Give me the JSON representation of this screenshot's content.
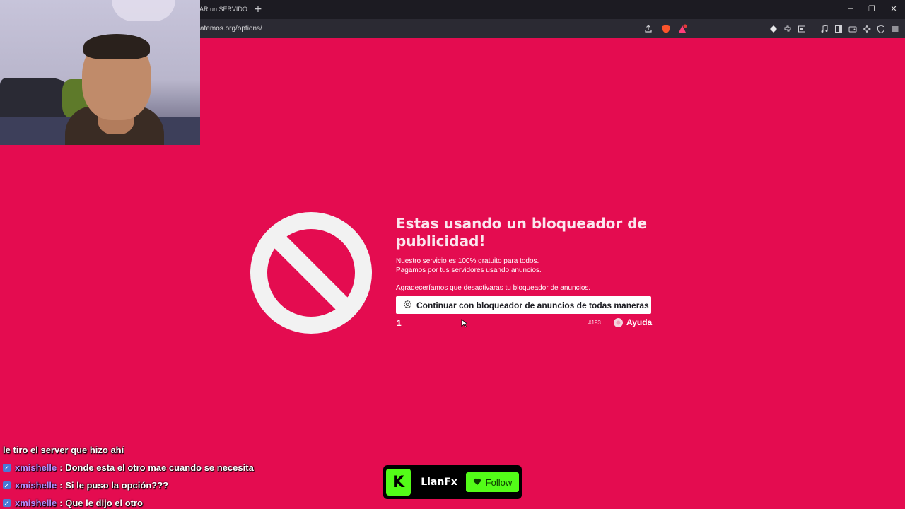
{
  "browser": {
    "tab_title": "AR un SERVIDOR",
    "new_tab": "+",
    "url": "atemos.org/options/",
    "window_controls": {
      "minimize": "─",
      "maximize": "❐",
      "close": "✕"
    },
    "toolbar_icons": [
      "share-icon",
      "shield-icon",
      "rewards-icon",
      "extension-icon",
      "puzzle-icon",
      "screenshot-icon",
      "media-icon",
      "sidebar-icon",
      "wallet-icon",
      "sparkle-icon",
      "vpn-icon",
      "menu-icon"
    ]
  },
  "page": {
    "background_color": "#e40c50",
    "title": "Estas usando un bloqueador de publicidad!",
    "line1": "Nuestro servicio es 100% gratuito para todos.",
    "line2": "Pagamos por tus servidores usando anuncios.",
    "thanks": "Agradeceríamos que desactivaras tu bloqueador de anuncios.",
    "continue_button": "Continuar con bloqueador de anuncios de todas maneras",
    "page_number": "1",
    "identifier": "#193",
    "help_label": "Ayuda"
  },
  "chat": {
    "messages": [
      {
        "user": "",
        "text": "le tiro el server que hizo ahí"
      },
      {
        "user": "xmishelle",
        "text": ": Donde esta el otro mae cuando se necesita"
      },
      {
        "user": "xmishelle",
        "text": ": Si le puso la opción???"
      },
      {
        "user": "xmishelle",
        "text": ": Que le dijo el otro"
      }
    ]
  },
  "kick": {
    "logo": "K",
    "streamer": "LianFx",
    "follow_label": "Follow",
    "accent": "#53fc18"
  }
}
